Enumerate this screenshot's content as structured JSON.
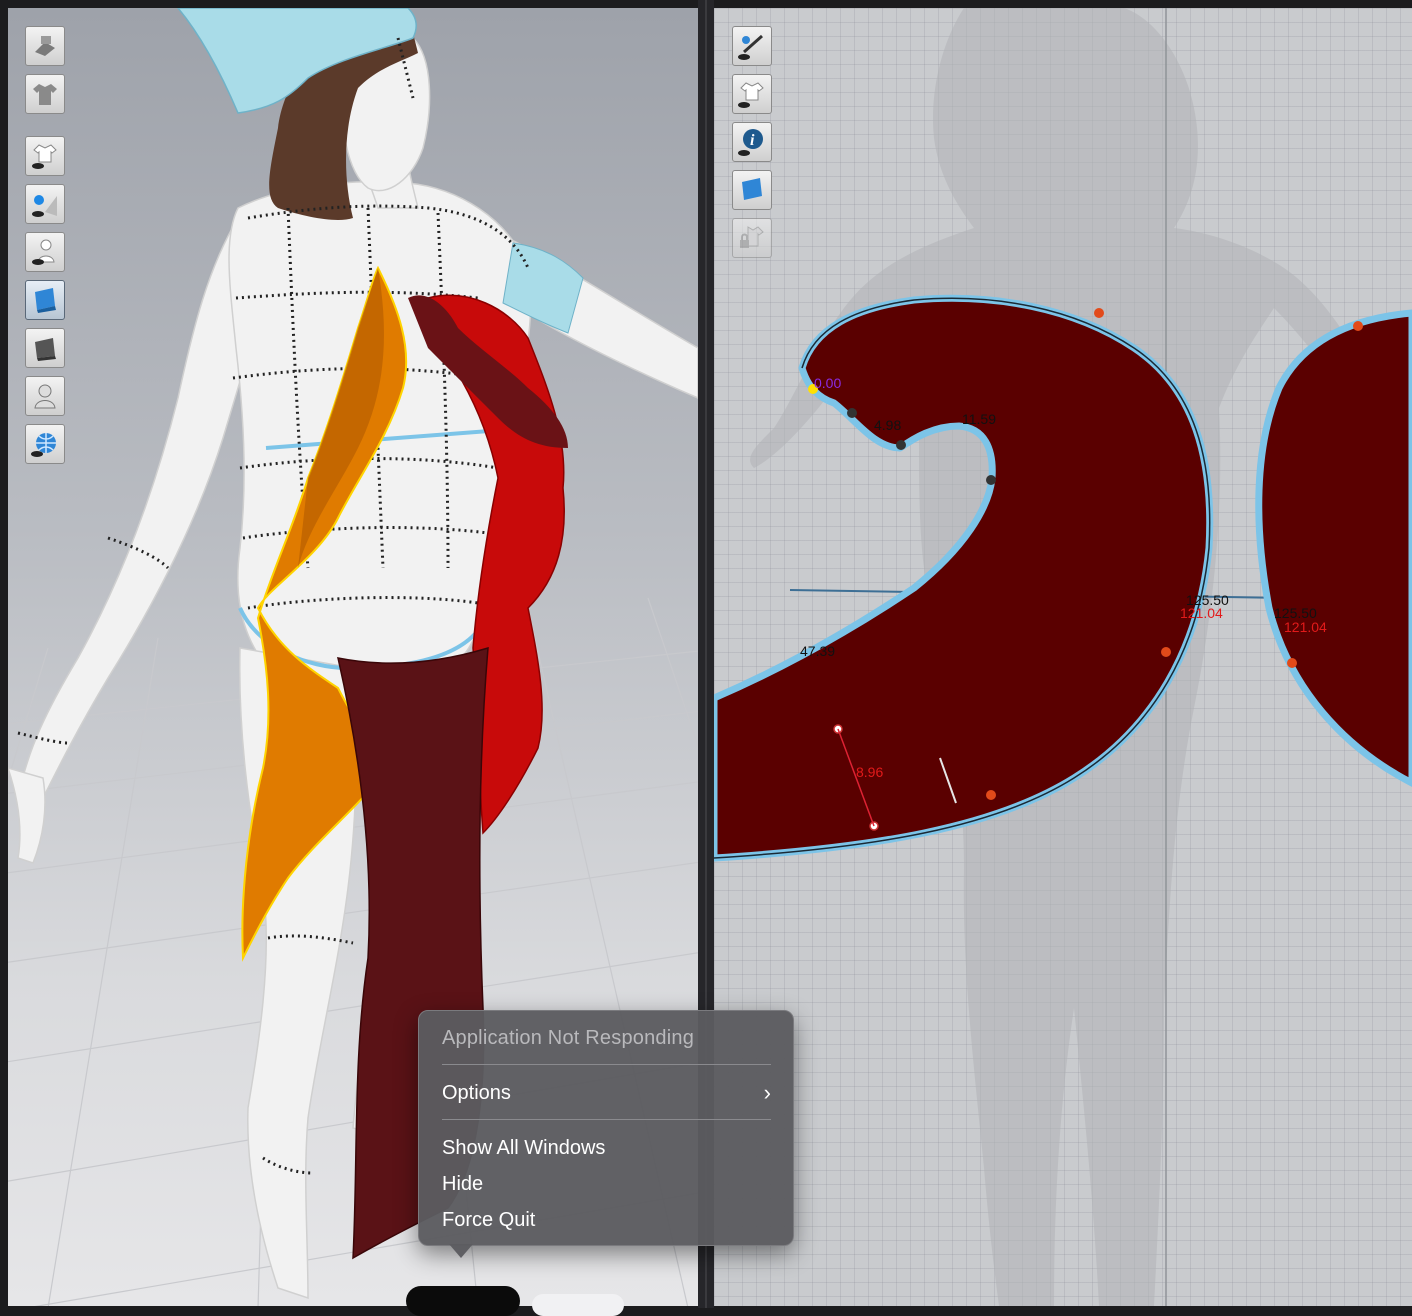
{
  "context_menu": {
    "header": "Application Not Responding",
    "items": [
      {
        "label": "Options"
      },
      {
        "label": "Show All Windows"
      },
      {
        "label": "Hide"
      },
      {
        "label": "Force Quit"
      }
    ]
  },
  "pattern_view": {
    "measurements": {
      "m1": "0.00",
      "m2": "4.98",
      "m3": "11.59",
      "m4": "125.50",
      "m5": "121.04",
      "m6": "125.50",
      "m7": "121.04",
      "m8": "47.39",
      "m9": "8.96"
    }
  },
  "toolbar_3d": {
    "icons": [
      "simulation-icon",
      "garment-icon",
      "show-garment-icon",
      "show-pins-icon",
      "show-avatar-icon",
      "fabric-texture-icon",
      "thickness-icon",
      "avatar-silhouette-icon",
      "environment-globe-icon"
    ]
  },
  "toolbar_2d": {
    "icons": [
      "show-needle-icon",
      "show-garment-2d-icon",
      "info-icon",
      "fabric-2d-icon",
      "lock-garment-icon"
    ]
  },
  "colors": {
    "fabric_dark": "#5a0000",
    "fabric_orange": "#e07b00",
    "fabric_red": "#c80a0a",
    "seam_blue": "#7cc4e8",
    "menu_bg": "#5c5c60"
  }
}
